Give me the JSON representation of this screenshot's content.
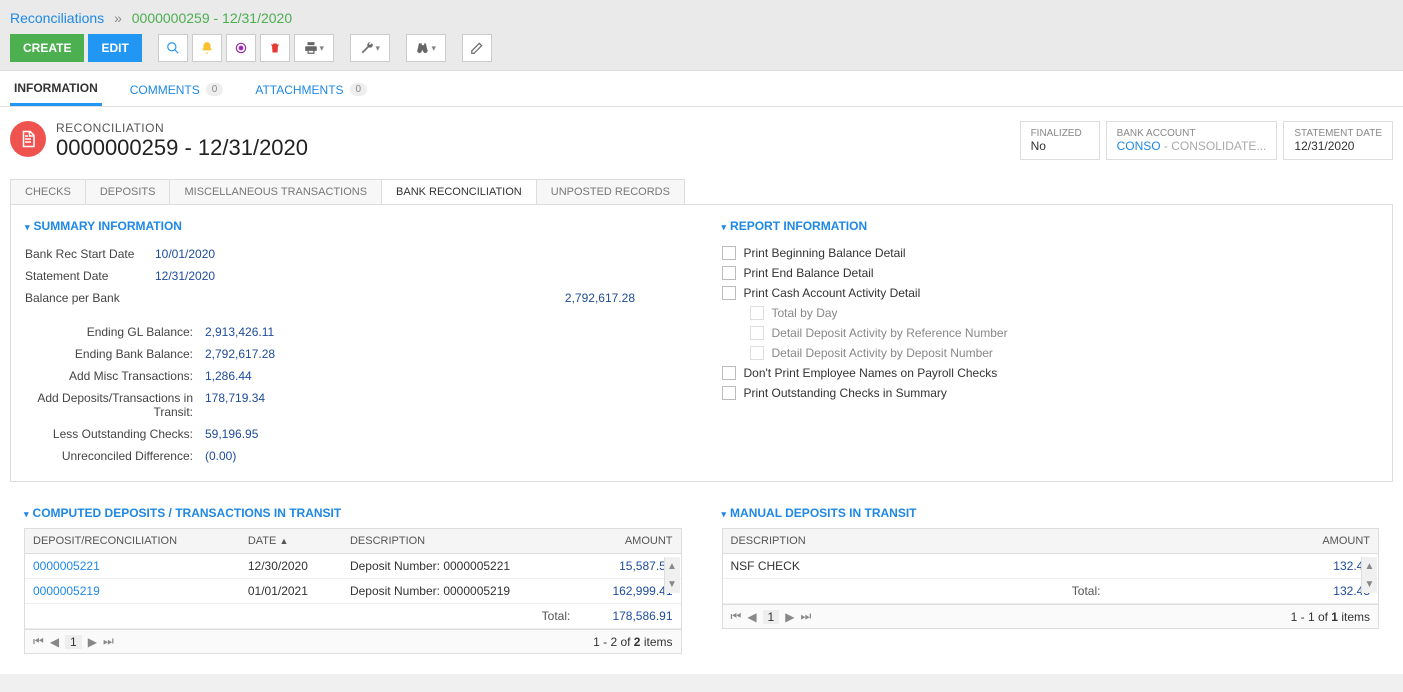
{
  "breadcrumb": {
    "root": "Reconciliations",
    "current": "0000000259 - 12/31/2020"
  },
  "toolbar": {
    "create": "CREATE",
    "edit": "EDIT"
  },
  "mainTabs": {
    "information": "INFORMATION",
    "comments": "COMMENTS",
    "comments_badge": "0",
    "attachments": "ATTACHMENTS",
    "attachments_badge": "0"
  },
  "header": {
    "label": "RECONCILIATION",
    "title": "0000000259 - 12/31/2020",
    "finalized_label": "FINALIZED",
    "finalized_value": "No",
    "bank_account_label": "BANK ACCOUNT",
    "bank_account_code": "CONSO",
    "bank_account_name": " - CONSOLIDATE...",
    "statement_date_label": "STATEMENT DATE",
    "statement_date_value": "12/31/2020"
  },
  "subtabs": {
    "checks": "CHECKS",
    "deposits": "DEPOSITS",
    "misc": "MISCELLANEOUS TRANSACTIONS",
    "bankrec": "BANK RECONCILIATION",
    "unposted": "UNPOSTED RECORDS"
  },
  "summary": {
    "title": "SUMMARY INFORMATION",
    "rows": {
      "start_label": "Bank Rec Start Date",
      "start_value": "10/01/2020",
      "stmt_label": "Statement Date",
      "stmt_value": "12/31/2020",
      "bpb_label": "Balance per Bank",
      "bpb_value": "2,792,617.28",
      "egl_label": "Ending GL Balance:",
      "egl_value": "2,913,426.11",
      "ebb_label": "Ending Bank Balance:",
      "ebb_value": "2,792,617.28",
      "amt_label": "Add Misc Transactions:",
      "amt_value": "1,286.44",
      "adt_label": "Add Deposits/Transactions in Transit:",
      "adt_value": "178,719.34",
      "loc_label": "Less Outstanding Checks:",
      "loc_value": "59,196.95",
      "urd_label": "Unreconciled Difference:",
      "urd_value": "(0.00)"
    }
  },
  "report": {
    "title": "REPORT INFORMATION",
    "opts": {
      "begin": "Print Beginning Balance Detail",
      "end": "Print End Balance Detail",
      "cash": "Print Cash Account Activity Detail",
      "tbd": "Total by Day",
      "ddar": "Detail Deposit Activity by Reference Number",
      "ddad": "Detail Deposit Activity by Deposit Number",
      "noemp": "Don't Print Employee Names on Payroll Checks",
      "outsum": "Print Outstanding Checks in Summary"
    }
  },
  "computed": {
    "title": "COMPUTED DEPOSITS / TRANSACTIONS IN TRANSIT",
    "cols": {
      "dep": "DEPOSIT/RECONCILIATION",
      "date": "DATE",
      "desc": "DESCRIPTION",
      "amt": "AMOUNT"
    },
    "rows": [
      {
        "dep": "0000005221",
        "date": "12/30/2020",
        "desc": "Deposit Number: 0000005221",
        "amt": "15,587.50"
      },
      {
        "dep": "0000005219",
        "date": "01/01/2021",
        "desc": "Deposit Number: 0000005219",
        "amt": "162,999.41"
      }
    ],
    "total_label": "Total:",
    "total_value": "178,586.91",
    "pager": "1 - 2 of 2 items"
  },
  "manual": {
    "title": "MANUAL DEPOSITS IN TRANSIT",
    "cols": {
      "desc": "DESCRIPTION",
      "amt": "AMOUNT"
    },
    "rows": [
      {
        "desc": "NSF CHECK",
        "amt": "132.43"
      }
    ],
    "total_label": "Total:",
    "total_value": "132.43",
    "pager": "1 - 1 of 1 items"
  }
}
